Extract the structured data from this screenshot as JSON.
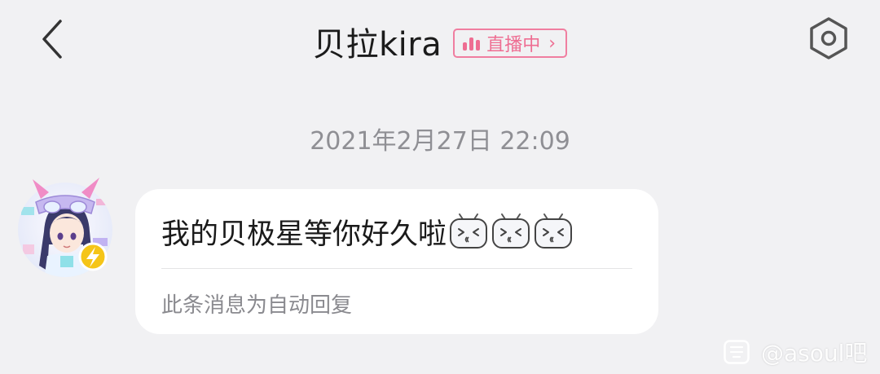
{
  "header": {
    "title": "贝拉kira",
    "live_badge": {
      "label": "直播中",
      "chevron": "›",
      "icon": "live-bars-icon",
      "color": "#ee6d92"
    },
    "back_icon": "chevron-left-icon",
    "settings_icon": "hexagon-gear-icon"
  },
  "chat": {
    "timestamp": "2021年2月27日 22:09",
    "messages": [
      {
        "sender_avatar": "avatar-with-lightning-badge",
        "text": "我的贝极星等你好久啦",
        "emoji_count": 3,
        "emoji": "bilibili-tv-laugh-emoji",
        "note": "此条消息为自动回复"
      }
    ]
  },
  "watermark": {
    "text": "@asoul吧",
    "logo": "tieba-logo"
  },
  "colors": {
    "background": "#f1f1f3",
    "bubble": "#ffffff",
    "accent": "#ee6d92",
    "badge": "#f5c518"
  }
}
